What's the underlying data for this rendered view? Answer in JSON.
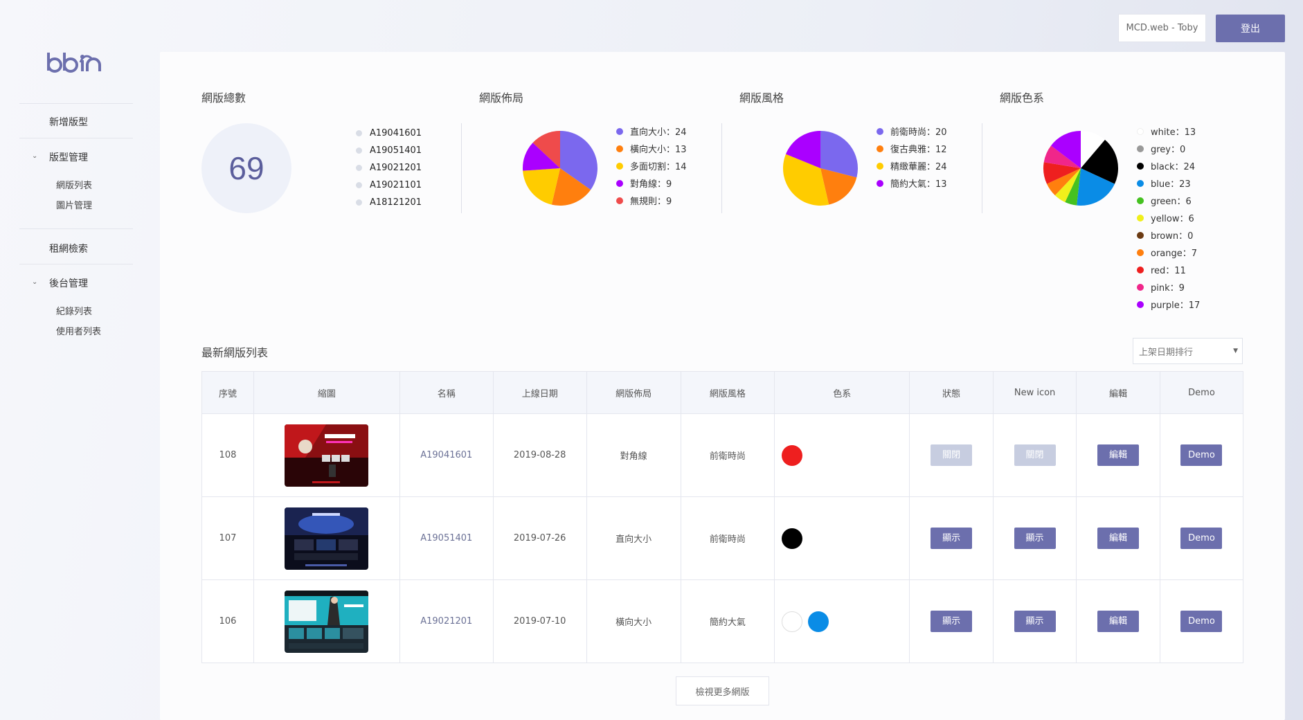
{
  "header": {
    "user_label": "MCD.web - Toby",
    "logout_label": "登出"
  },
  "brand": {
    "logo_text": "bbin",
    "color": "#6c6fad"
  },
  "sidebar": {
    "items": [
      {
        "label": "新增版型"
      },
      {
        "label": "版型管理",
        "expanded": true,
        "children": [
          {
            "label": "網版列表"
          },
          {
            "label": "圖片管理"
          }
        ]
      },
      {
        "label": "租網檢索"
      },
      {
        "label": "後台管理",
        "expanded": true,
        "children": [
          {
            "label": "紀錄列表"
          },
          {
            "label": "使用者列表"
          }
        ]
      }
    ]
  },
  "stats": {
    "total_title": "網版總數",
    "total_value": "69",
    "recent_ids": [
      "A19041601",
      "A19051401",
      "A19021201",
      "A19021101",
      "A18121201"
    ]
  },
  "chart_data": [
    {
      "type": "pie",
      "title": "網版佈局",
      "categories": [
        "直向大小",
        "橫向大小",
        "多面切割",
        "對角線",
        "無規則"
      ],
      "values": [
        24,
        13,
        14,
        9,
        9
      ],
      "colors": [
        "#7b68ee",
        "#ff7f0e",
        "#ffcc00",
        "#aa00ff",
        "#ef4b4b"
      ]
    },
    {
      "type": "pie",
      "title": "網版風格",
      "categories": [
        "前衛時尚",
        "復古典雅",
        "精緻華麗",
        "簡約大氣"
      ],
      "values": [
        20,
        12,
        24,
        13
      ],
      "colors": [
        "#7b68ee",
        "#ff7f0e",
        "#ffcc00",
        "#aa00ff"
      ]
    },
    {
      "type": "pie",
      "title": "網版色系",
      "categories": [
        "white",
        "grey",
        "black",
        "blue",
        "green",
        "yellow",
        "brown",
        "orange",
        "red",
        "pink",
        "purple"
      ],
      "values": [
        13,
        0,
        24,
        23,
        6,
        6,
        0,
        7,
        11,
        9,
        17
      ],
      "colors": [
        "#ffffff",
        "#999999",
        "#000000",
        "#0a8ce6",
        "#45c120",
        "#f0ef1b",
        "#6b3a12",
        "#ff7f0e",
        "#ee1f1f",
        "#f0268a",
        "#aa00ff"
      ]
    }
  ],
  "list": {
    "title": "最新網版列表",
    "sort_label": "上架日期排行",
    "columns": [
      "序號",
      "縮圖",
      "名稱",
      "上線日期",
      "網版佈局",
      "網版風格",
      "色系",
      "狀態",
      "New icon",
      "編輯",
      "Demo"
    ],
    "rows": [
      {
        "no": "108",
        "name": "A19041601",
        "date": "2019-08-28",
        "layout": "對角線",
        "style": "前衛時尚",
        "colors": [
          "#ee1f1f"
        ],
        "status": "關閉",
        "status_on": false,
        "new_icon": "關閉",
        "new_on": false,
        "edit": "編輯",
        "demo": "Demo",
        "thumb": "red-casino-site-thumbnail"
      },
      {
        "no": "107",
        "name": "A19051401",
        "date": "2019-07-26",
        "layout": "直向大小",
        "style": "前衛時尚",
        "colors": [
          "#000000"
        ],
        "status": "顯示",
        "status_on": true,
        "new_icon": "顯示",
        "new_on": true,
        "edit": "編輯",
        "demo": "Demo",
        "thumb": "dark-blue-site-thumbnail"
      },
      {
        "no": "106",
        "name": "A19021201",
        "date": "2019-07-10",
        "layout": "橫向大小",
        "style": "簡約大氣",
        "colors": [
          "#ffffff",
          "#0a8ce6"
        ],
        "status": "顯示",
        "status_on": true,
        "new_icon": "顯示",
        "new_on": true,
        "edit": "編輯",
        "demo": "Demo",
        "thumb": "teal-site-thumbnail"
      }
    ],
    "more_label": "檢視更多網版"
  }
}
